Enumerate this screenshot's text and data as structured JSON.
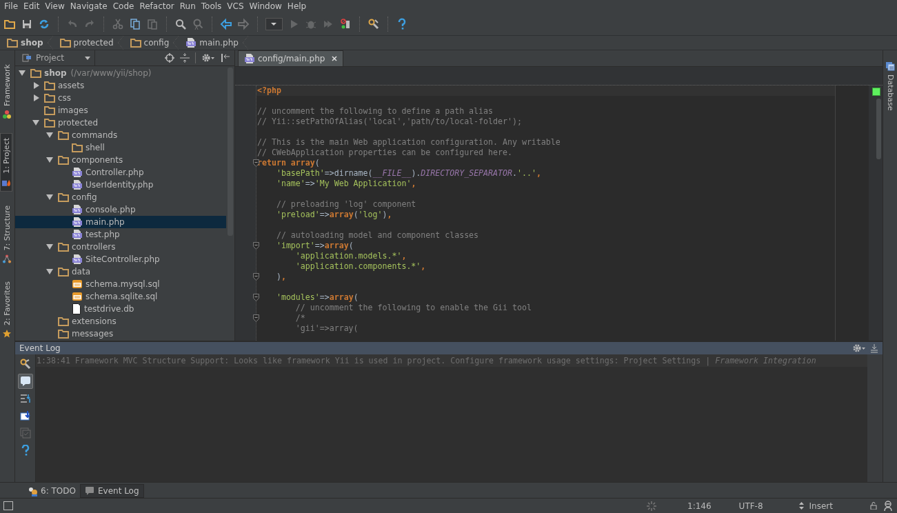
{
  "menu_bar": [
    "File",
    "Edit",
    "View",
    "Navigate",
    "Code",
    "Refactor",
    "Run",
    "Tools",
    "VCS",
    "Window",
    "Help"
  ],
  "toolbar": [
    {
      "disabled": false
    },
    {
      "disabled": false
    },
    {
      "disabled": false
    },
    {
      "disabled": true
    },
    {
      "disabled": true
    },
    {
      "disabled": true
    },
    {
      "disabled": false
    },
    {
      "disabled": true
    },
    {
      "disabled": false
    },
    {
      "disabled": true
    },
    {
      "disabled": false
    },
    {
      "disabled": true
    },
    {
      "disabled": false
    },
    {
      "disabled": true
    },
    {
      "disabled": true
    },
    {
      "disabled": true
    },
    {
      "disabled": false
    },
    {
      "disabled": false
    },
    {
      "disabled": false
    }
  ],
  "breadcrumbs": [
    {
      "label": "shop",
      "kind": "folder"
    },
    {
      "label": "protected",
      "kind": "folder"
    },
    {
      "label": "config",
      "kind": "folder"
    },
    {
      "label": "main.php",
      "kind": "php"
    }
  ],
  "left_tool_tabs": [
    {
      "label": "Framework",
      "selected": false
    },
    {
      "label": "1: Project",
      "selected": true
    },
    {
      "label": "7: Structure",
      "selected": false
    },
    {
      "label": "2: Favorites",
      "selected": false
    }
  ],
  "right_tool_tabs": [
    {
      "label": "Database",
      "selected": false
    }
  ],
  "project_panel": {
    "view": "Project",
    "tree": [
      {
        "name": "shop",
        "note": "(/var/www/yii/shop)",
        "kind": "folder",
        "expanded": true,
        "selected": false,
        "children": [
          {
            "name": "assets",
            "kind": "folder",
            "expanded": false,
            "selected": false
          },
          {
            "name": "css",
            "kind": "folder",
            "expanded": false,
            "selected": false
          },
          {
            "name": "images",
            "kind": "folder",
            "selected": false
          },
          {
            "name": "protected",
            "kind": "folder",
            "expanded": true,
            "selected": false,
            "children": [
              {
                "name": "commands",
                "kind": "folder",
                "expanded": true,
                "selected": false,
                "children": [
                  {
                    "name": "shell",
                    "kind": "folder",
                    "selected": false
                  }
                ]
              },
              {
                "name": "components",
                "kind": "folder",
                "expanded": true,
                "selected": false,
                "children": [
                  {
                    "name": "Controller.php",
                    "kind": "php",
                    "selected": false
                  },
                  {
                    "name": "UserIdentity.php",
                    "kind": "php",
                    "selected": false
                  }
                ]
              },
              {
                "name": "config",
                "kind": "folder",
                "expanded": true,
                "selected": false,
                "children": [
                  {
                    "name": "console.php",
                    "kind": "php",
                    "selected": false
                  },
                  {
                    "name": "main.php",
                    "kind": "php",
                    "selected": true
                  },
                  {
                    "name": "test.php",
                    "kind": "php",
                    "selected": false
                  }
                ]
              },
              {
                "name": "controllers",
                "kind": "folder",
                "expanded": true,
                "selected": false,
                "children": [
                  {
                    "name": "SiteController.php",
                    "kind": "php",
                    "selected": false
                  }
                ]
              },
              {
                "name": "data",
                "kind": "folder",
                "expanded": true,
                "selected": false,
                "children": [
                  {
                    "name": "schema.mysql.sql",
                    "kind": "sql",
                    "selected": false
                  },
                  {
                    "name": "schema.sqlite.sql",
                    "kind": "sql",
                    "selected": false
                  },
                  {
                    "name": "testdrive.db",
                    "kind": "file",
                    "selected": false
                  }
                ]
              },
              {
                "name": "extensions",
                "kind": "folder",
                "selected": false
              },
              {
                "name": "messages",
                "kind": "folder",
                "selected": false
              }
            ]
          }
        ]
      }
    ]
  },
  "editor": {
    "tabs": [
      {
        "label": "config/main.php",
        "selected": true
      }
    ],
    "lines": [
      {
        "fold": false,
        "segments": [
          {
            "kind": "tag",
            "text": "<?php"
          }
        ]
      },
      {
        "fold": false
      },
      {
        "fold": false,
        "segments": [
          {
            "kind": "comment",
            "text": "// uncomment the following to define a path alias"
          }
        ]
      },
      {
        "fold": false,
        "segments": [
          {
            "kind": "comment",
            "text": "// Yii::setPathOfAlias('local','path/to/local-folder');"
          }
        ]
      },
      {
        "fold": false
      },
      {
        "fold": false,
        "segments": [
          {
            "kind": "comment",
            "text": "// This is the main Web application configuration. Any writable"
          }
        ]
      },
      {
        "fold": false,
        "segments": [
          {
            "kind": "comment",
            "text": "// CWebApplication properties can be configured here."
          }
        ]
      },
      {
        "fold": true,
        "segments": [
          {
            "kind": "keyword",
            "text": "return array"
          },
          {
            "kind": "plain",
            "text": "("
          }
        ]
      },
      {
        "fold": false,
        "segments": [
          {
            "kind": "string",
            "text": "    'basePath'"
          },
          {
            "kind": "plain",
            "text": "=>dirname("
          },
          {
            "kind": "constant",
            "text": "__FILE__"
          },
          {
            "kind": "plain",
            "text": ")."
          },
          {
            "kind": "constant",
            "text": "DIRECTORY_SEPARATOR"
          },
          {
            "kind": "plain",
            "text": "."
          },
          {
            "kind": "string",
            "text": "'..'"
          },
          {
            "kind": "keyword",
            "text": ","
          }
        ]
      },
      {
        "fold": false,
        "segments": [
          {
            "kind": "string",
            "text": "    'name'"
          },
          {
            "kind": "plain",
            "text": "=>"
          },
          {
            "kind": "string",
            "text": "'My Web Application'"
          },
          {
            "kind": "keyword",
            "text": ","
          }
        ]
      },
      {
        "fold": false
      },
      {
        "fold": false,
        "segments": [
          {
            "kind": "comment",
            "text": "    // preloading 'log' component"
          }
        ]
      },
      {
        "fold": false,
        "segments": [
          {
            "kind": "string",
            "text": "    'preload'"
          },
          {
            "kind": "plain",
            "text": "=>"
          },
          {
            "kind": "keyword",
            "text": "array"
          },
          {
            "kind": "plain",
            "text": "("
          },
          {
            "kind": "string",
            "text": "'log'"
          },
          {
            "kind": "plain",
            "text": ")"
          },
          {
            "kind": "keyword",
            "text": ","
          }
        ]
      },
      {
        "fold": false
      },
      {
        "fold": false,
        "segments": [
          {
            "kind": "comment",
            "text": "    // autoloading model and component classes"
          }
        ]
      },
      {
        "fold": true,
        "segments": [
          {
            "kind": "string",
            "text": "    'import'"
          },
          {
            "kind": "plain",
            "text": "=>"
          },
          {
            "kind": "keyword",
            "text": "array"
          },
          {
            "kind": "plain",
            "text": "("
          }
        ]
      },
      {
        "fold": false,
        "segments": [
          {
            "kind": "string",
            "text": "        'application.models.*'"
          },
          {
            "kind": "keyword",
            "text": ","
          }
        ]
      },
      {
        "fold": false,
        "segments": [
          {
            "kind": "string",
            "text": "        'application.components.*'"
          },
          {
            "kind": "keyword",
            "text": ","
          }
        ]
      },
      {
        "fold": true,
        "segments": [
          {
            "kind": "plain",
            "text": "    )"
          },
          {
            "kind": "keyword",
            "text": ","
          }
        ]
      },
      {
        "fold": false
      },
      {
        "fold": true,
        "segments": [
          {
            "kind": "string",
            "text": "    'modules'"
          },
          {
            "kind": "plain",
            "text": "=>"
          },
          {
            "kind": "keyword",
            "text": "array"
          },
          {
            "kind": "plain",
            "text": "("
          }
        ]
      },
      {
        "fold": false,
        "segments": [
          {
            "kind": "comment",
            "text": "        // uncomment the following to enable the Gii tool"
          }
        ]
      },
      {
        "fold": true,
        "segments": [
          {
            "kind": "comment",
            "text": "        /*"
          }
        ]
      },
      {
        "fold": false,
        "segments": [
          {
            "kind": "comment",
            "text": "        'gii'=>array("
          }
        ]
      }
    ]
  },
  "event_log": {
    "title": "Event Log",
    "tools": [
      {
        "selected": false
      },
      {
        "selected": true
      },
      {
        "selected": false
      },
      {
        "selected": false
      },
      {
        "selected": false
      },
      {
        "selected": false
      }
    ],
    "message": {
      "time": "1:38:41",
      "text": "Framework MVC Structure Support: Looks like framework Yii is used in project. Configure framework usage settings: Project Settings | ",
      "link": "Framework Integration"
    }
  },
  "bottom_tabs": [
    {
      "label": "6: TODO",
      "selected": false
    },
    {
      "label": "Event Log",
      "selected": true
    }
  ],
  "status_bar": {
    "position": "1:146",
    "encoding": "UTF-8",
    "mode": "Insert"
  }
}
